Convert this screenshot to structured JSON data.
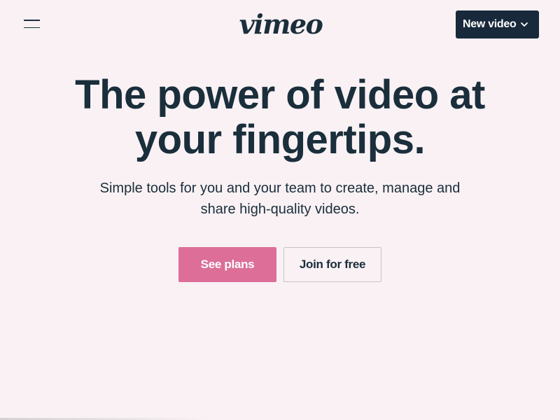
{
  "header": {
    "logo_text": "vimeo",
    "menu_icon": "hamburger-menu-icon",
    "new_video_label": "New video",
    "new_video_icon": "chevron-down-icon"
  },
  "hero": {
    "title_line1": "The power of video at",
    "title_line2": "your fingertips.",
    "subtitle_line1": "Simple tools for you and your team to create, manage and",
    "subtitle_line2": "share high-quality videos."
  },
  "cta": {
    "see_plans_label": "See plans",
    "join_label": "Join for free"
  },
  "colors": {
    "background": "#f9f1f4",
    "text": "#1a2e3b",
    "primary_button": "#dc6e97",
    "dark_button": "#17293a"
  }
}
